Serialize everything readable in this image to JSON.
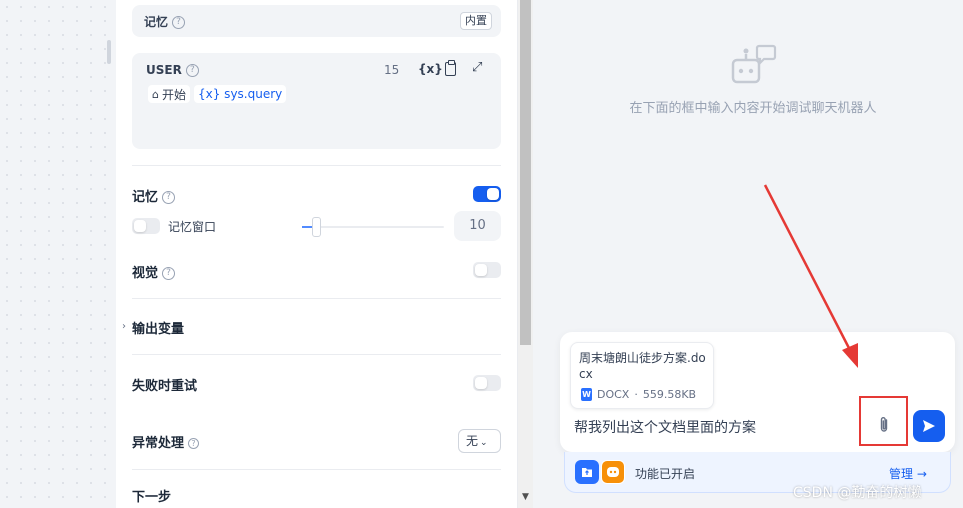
{
  "config": {
    "memory_section": {
      "title": "记忆",
      "tag": "内置"
    },
    "user_prompt": {
      "title": "USER",
      "count": "15",
      "var_button": "{x}",
      "chips": [
        {
          "label": "开始"
        },
        {
          "label": "{x} sys.query"
        }
      ]
    },
    "memory": {
      "label": "记忆",
      "enabled": true
    },
    "memory_window": {
      "label": "记忆窗口",
      "value": "10",
      "enabled": false
    },
    "vision": {
      "label": "视觉",
      "enabled": false
    },
    "output_vars": {
      "label": "输出变量"
    },
    "retry_on_fail": {
      "label": "失败时重试",
      "enabled": false
    },
    "error_handling": {
      "label": "异常处理",
      "select_value": "无"
    },
    "next_step": {
      "label": "下一步"
    }
  },
  "chat": {
    "empty_hint": "在下面的框中输入内容开始调试聊天机器人",
    "file": {
      "name": "周末塘朗山徒步方案.docx",
      "type": "DOCX",
      "size": "559.58KB"
    },
    "input_value": "帮我列出这个文档里面的方案",
    "features": {
      "label": "功能已开启",
      "manage_label": "管理"
    }
  },
  "watermark": "CSDN @勤奋的树懒",
  "colors": {
    "accent": "#155eef",
    "annotation_red": "#e53935",
    "feature_orange": "#f79009"
  }
}
